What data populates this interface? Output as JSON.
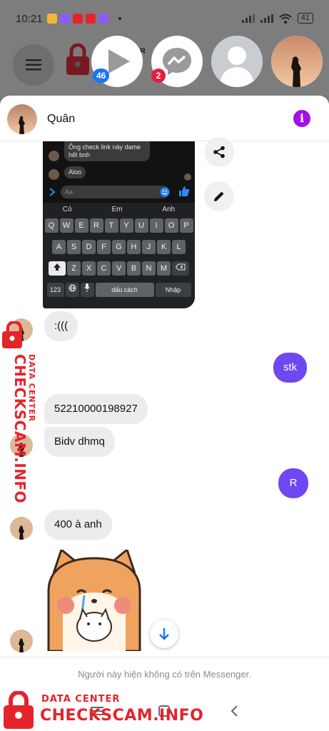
{
  "status_bar": {
    "time": "10:21",
    "battery": "41",
    "app_icons": [
      {
        "name": "notes-app-icon",
        "color": "#f6b53d"
      },
      {
        "name": "messenger-app-icon",
        "color": "#8d5cf6"
      },
      {
        "name": "vivaldi-app-icon",
        "color": "#e3242b"
      },
      {
        "name": "game-app-icon",
        "color": "#e3242b"
      },
      {
        "name": "messenger-app-icon-2",
        "color": "#8d5cf6"
      }
    ]
  },
  "chat_heads": {
    "badges": {
      "video": "46",
      "messenger": "2"
    },
    "behind_text": "TER"
  },
  "chat": {
    "contact_name": "Quân",
    "screenshot": {
      "messages": [
        "Ông check link này dame hết bnh",
        "Aloo"
      ],
      "input_placeholder": "Aa",
      "suggestions": [
        "Có",
        "Em",
        "Anh"
      ],
      "rows": [
        [
          "Q",
          "W",
          "E",
          "R",
          "T",
          "Y",
          "U",
          "I",
          "O",
          "P"
        ],
        [
          "A",
          "S",
          "D",
          "F",
          "G",
          "H",
          "J",
          "K",
          "L"
        ],
        [
          "Z",
          "X",
          "C",
          "V",
          "B",
          "N",
          "M"
        ]
      ],
      "key_123": "123",
      "space_label": "dấu cách",
      "enter_label": "Nhập"
    },
    "messages": [
      {
        "dir": "in",
        "text": ":((("
      },
      {
        "dir": "out",
        "text": "stk"
      },
      {
        "dir": "in",
        "text": "52210000198927"
      },
      {
        "dir": "in",
        "text": "Bidv dhmq"
      },
      {
        "dir": "out",
        "text": "R"
      },
      {
        "dir": "in",
        "text": "400 à anh"
      }
    ],
    "unavailable_notice": "Người này hiện không có trên Messenger."
  },
  "watermark": {
    "small": "DATA CENTER",
    "big": "CHECKSCAM.INFO"
  },
  "colors": {
    "accent_out": "#6e48f0",
    "info": "#a40fe8",
    "badge_blue": "#1877f2",
    "badge_red": "#e41e3f",
    "watermark": "#e3242b"
  }
}
